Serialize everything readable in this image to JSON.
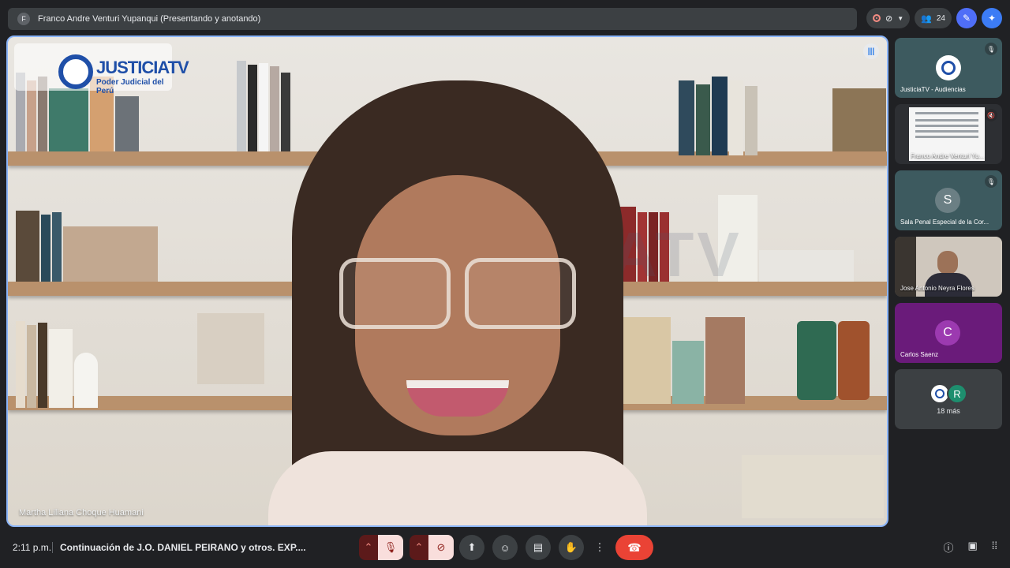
{
  "topbar": {
    "avatar_letter": "F",
    "presenter_title": "Franco Andre Venturi Yupanqui (Presentando y anotando)"
  },
  "top_controls": {
    "participant_count": "24",
    "record_icon": "record-icon",
    "camera_off_icon": "camera-off-icon",
    "people_icon": "people-icon",
    "pen_icon": "pen-icon",
    "ai_icon": "sparkle-icon"
  },
  "main_video": {
    "logo_text": "JUSTICIATV",
    "logo_sub": "Poder Judicial del Perú",
    "watermark": "JUSTICIATV",
    "speaker_name": "Martha Liliana Choque Huamani"
  },
  "participants": [
    {
      "name": "JusticiaTV - Audiencias",
      "type": "logo",
      "bg": "#3d5a5f",
      "muted": true
    },
    {
      "name": "Franco Andre Venturi Yu...",
      "type": "screen",
      "bg": "#2d2f33",
      "muted": false
    },
    {
      "name": "Sala Penal Especial de la Cor...",
      "type": "avatar",
      "letter": "S",
      "bg": "#3d5a5f",
      "avatar_bg": "#6b7f84",
      "muted": true
    },
    {
      "name": "Jose Antonio Neyra Flores",
      "type": "video",
      "bg": "#7a6f64",
      "muted": false
    },
    {
      "name": "Carlos Saenz",
      "type": "avatar",
      "letter": "C",
      "bg": "#6a1b7a",
      "avatar_bg": "#9c3ab0",
      "muted": false
    }
  ],
  "more_tile": {
    "avatar_letter": "R",
    "label": "18 más"
  },
  "bottombar": {
    "clock": "2:11 p.m.",
    "meeting_title": "Continuación de J.O. DANIEL PEIRANO y otros. EXP....",
    "hangup_icon": "hangup-icon"
  },
  "colors": {
    "accent": "#8ab4f8",
    "hangup": "#ea4335",
    "background": "#202124"
  }
}
